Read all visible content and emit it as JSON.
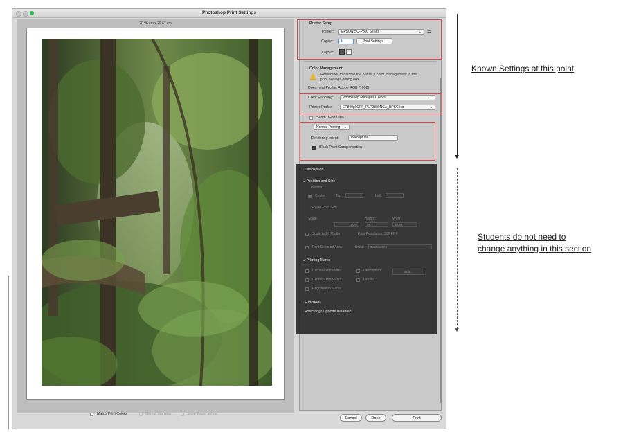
{
  "window": {
    "title": "Photoshop Print Settings"
  },
  "preview": {
    "paper_size": "20.96 cm x 29.67 cm"
  },
  "printer_setup": {
    "heading": "Printer Setup",
    "printer_label": "Printer:",
    "printer_value": "EPSON SC-P800 Series",
    "copies_label": "Copies:",
    "copies_value": "1",
    "print_settings_button": "Print Settings...",
    "layout_label": "Layout:"
  },
  "color_management": {
    "heading": "Color Management",
    "warning": "Remember to disable the printer's color management in the print settings dialog box.",
    "document_profile": "Document Profile: Adobe RGB (1998)",
    "color_handling_label": "Color Handling:",
    "color_handling_value": "Photoshop Manages Colors",
    "printer_profile_label": "Printer Profile:",
    "printer_profile_value": "EP800pkCPF_PLP2880NCA_BPSC.icc",
    "send16_label": "Send 16-bit Data",
    "normal_printing_value": "Normal Printing",
    "rendering_intent_label": "Rendering Intent:",
    "rendering_intent_value": "Perceptual",
    "bpc_label": "Black Point Compensation"
  },
  "sections": {
    "description": "Description",
    "position_and_size": "Position and Size",
    "position": "Position",
    "center": "Center",
    "top": "Top:",
    "left": "Left:",
    "scaled_print_size": "Scaled Print Size",
    "scale": "Scale:",
    "height": "Height:",
    "width": "Width:",
    "scale_value": "100%",
    "height_value": "29.7",
    "width_value": "20.99",
    "scale_to_fit": "Scale to Fit Media",
    "print_resolution": "Print Resolution: 300 PPI",
    "print_selected_area": "Print Selected Area",
    "units_label": "Units:",
    "units_value": "Centimeters",
    "printing_marks": "Printing Marks",
    "corner_crop_marks": "Corner Crop Marks",
    "description_cb": "Description",
    "edit_button": "Edit...",
    "center_crop_marks": "Center Crop Marks",
    "labels": "Labels",
    "registration_marks": "Registration Marks",
    "functions": "Functions",
    "postscript": "PostScript Options Disabled"
  },
  "bottom_bar": {
    "match_print_colors": "Match Print Colors",
    "gamut_warning": "Gamut Warning",
    "show_paper_white": "Show Paper White",
    "cancel": "Cancel",
    "done": "Done",
    "print": "Print"
  },
  "annotations": {
    "known_settings": "Known Settings at this point",
    "students_line1": "Students do not need to",
    "students_line2": "change anything in this section"
  },
  "colors": {
    "highlight_red": "#e0454a",
    "overlay": "#1e1e1e"
  }
}
